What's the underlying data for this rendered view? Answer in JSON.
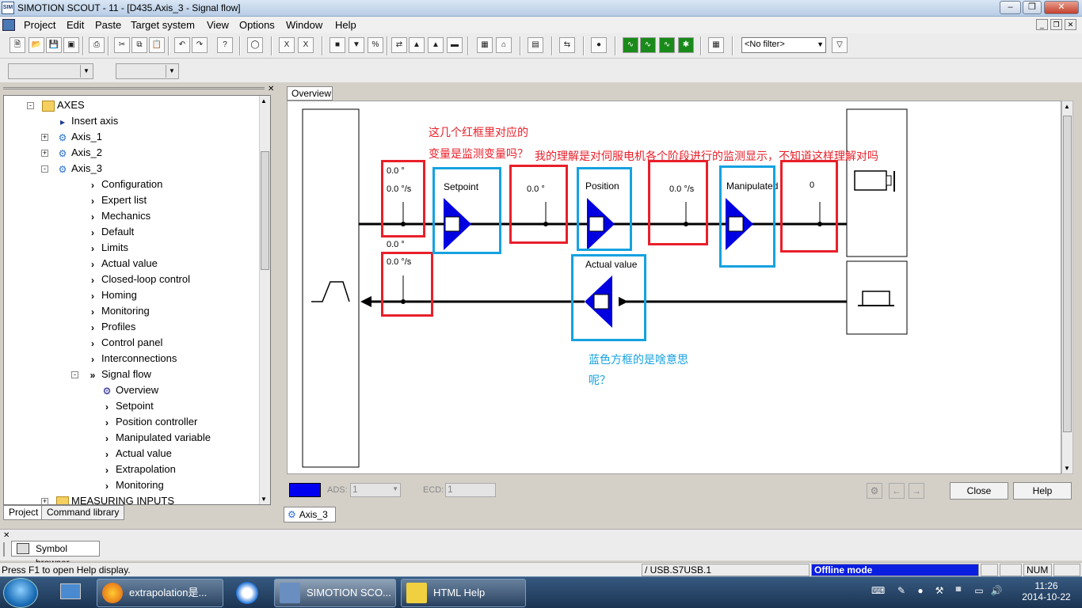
{
  "window": {
    "title": "SIMOTION SCOUT - 11 - [D435.Axis_3 - Signal flow]",
    "app_icon_text": "SIM"
  },
  "menu": [
    "Project",
    "Edit",
    "Paste",
    "Target system",
    "View",
    "Options",
    "Window",
    "Help"
  ],
  "toolbar": {
    "filter_value": "<No filter>"
  },
  "tree": {
    "items": [
      {
        "label": "AXES",
        "level": 0,
        "icon": "folder-icon",
        "exp": "-"
      },
      {
        "label": "Insert axis",
        "level": 1,
        "icon": "insert-icon"
      },
      {
        "label": "Axis_1",
        "level": 1,
        "icon": "axis-icon",
        "exp": "+"
      },
      {
        "label": "Axis_2",
        "level": 1,
        "icon": "axis-icon",
        "exp": "+"
      },
      {
        "label": "Axis_3",
        "level": 1,
        "icon": "axis-icon",
        "exp": "-"
      },
      {
        "label": "Configuration",
        "level": 2,
        "icon": "chevron-icon"
      },
      {
        "label": "Expert list",
        "level": 2,
        "icon": "chevron-icon"
      },
      {
        "label": "Mechanics",
        "level": 2,
        "icon": "chevron-icon"
      },
      {
        "label": "Default",
        "level": 2,
        "icon": "chevron-icon"
      },
      {
        "label": "Limits",
        "level": 2,
        "icon": "chevron-icon"
      },
      {
        "label": "Actual value",
        "level": 2,
        "icon": "chevron-icon"
      },
      {
        "label": "Closed-loop control",
        "level": 2,
        "icon": "chevron-icon"
      },
      {
        "label": "Homing",
        "level": 2,
        "icon": "chevron-icon"
      },
      {
        "label": "Monitoring",
        "level": 2,
        "icon": "chevron-icon"
      },
      {
        "label": "Profiles",
        "level": 2,
        "icon": "chevron-icon"
      },
      {
        "label": "Control panel",
        "level": 2,
        "icon": "chevron-icon"
      },
      {
        "label": "Interconnections",
        "level": 2,
        "icon": "chevron-icon"
      },
      {
        "label": "Signal flow",
        "level": 2,
        "icon": "double-chevron-icon",
        "exp": "-"
      },
      {
        "label": "Overview",
        "level": 3,
        "icon": "gear-icon"
      },
      {
        "label": "Setpoint",
        "level": 3,
        "icon": "chevron-icon"
      },
      {
        "label": "Position controller",
        "level": 3,
        "icon": "chevron-icon"
      },
      {
        "label": "Manipulated variable",
        "level": 3,
        "icon": "chevron-icon"
      },
      {
        "label": "Actual value",
        "level": 3,
        "icon": "chevron-icon"
      },
      {
        "label": "Extrapolation",
        "level": 3,
        "icon": "chevron-icon"
      },
      {
        "label": "Monitoring",
        "level": 3,
        "icon": "chevron-icon"
      },
      {
        "label": "MEASURING INPUTS",
        "level": 1,
        "icon": "folder-icon",
        "exp": "+"
      }
    ],
    "tabs": {
      "project": "Project",
      "command_library": "Command library"
    }
  },
  "signal_flow": {
    "tab": "Overview",
    "setpoint_label": "Setpoint",
    "position_label": "Position",
    "manipulated_label": "Manipulated",
    "actual_value_label": "Actual value",
    "top_pos_value": "0.0  °",
    "top_vel_value": "0.0  °/s",
    "after_setpoint_value": "0.0  °",
    "after_position_value": "0.0  °/s",
    "after_manipulated_value": "0",
    "bottom_pos_value": "0.0  °",
    "bottom_vel_value": "0.0  °/s"
  },
  "annotations": {
    "red_text_line1": "这几个红框里对应的",
    "red_text_line2": "变量是监测变量吗？",
    "red_text_line3": "我的理解是对伺服电机各个阶段进行的监测显示，不知道这样理解对吗",
    "blue_text_line1": "蓝色方框的是啥意思",
    "blue_text_line2": "呢？"
  },
  "bottom": {
    "ads_label": "ADS:",
    "ads_value": "1",
    "ecd_label": "ECD:",
    "ecd_value": "1",
    "close": "Close",
    "help": "Help"
  },
  "doc_tab": "Axis_3",
  "symbol_browser": "Symbol browser",
  "status": {
    "help": "Press F1 to open Help display.",
    "connection": "/ USB.S7USB.1",
    "mode": "Offline mode",
    "num": "NUM"
  },
  "taskbar": {
    "tasks": [
      "extrapolation是...",
      "SIMOTION SCO...",
      "HTML Help"
    ],
    "time": "11:26",
    "date": "2014-10-22"
  },
  "colors": {
    "red": "#e8202a",
    "blue_annot": "#15a2e0",
    "block_blue": "#0000e0",
    "offline_mode": "#0a1ee0"
  }
}
